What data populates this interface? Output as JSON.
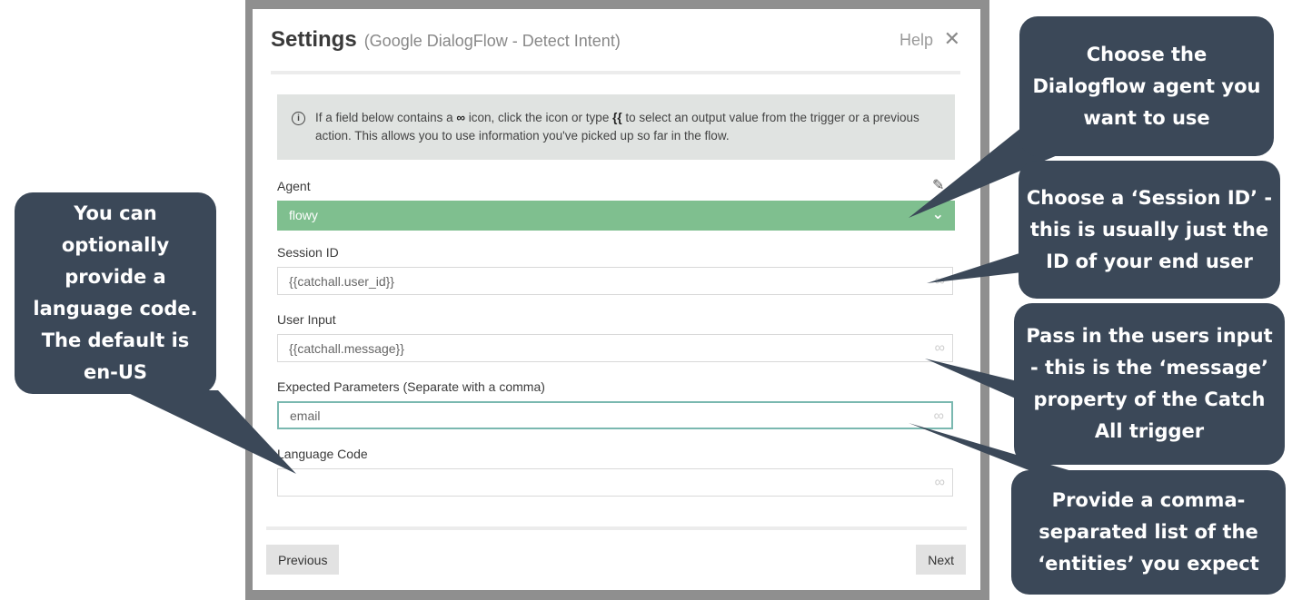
{
  "modal": {
    "title": "Settings",
    "subtitle": "(Google DialogFlow - Detect Intent)",
    "help_label": "Help",
    "close_glyph": "✕"
  },
  "info": {
    "icon": "info-icon",
    "text_part1": "If a field below contains a",
    "text_icon": "∞",
    "text_part2": "icon, click the icon or type",
    "text_braces": "{{",
    "text_part3": "to select an output value from the trigger or a previous action. This allows you to use information you've picked up so far in the flow."
  },
  "fields": {
    "agent": {
      "label": "Agent",
      "value": "flowy"
    },
    "session_id": {
      "label": "Session ID",
      "value": "{{catchall.user_id}}"
    },
    "user_input": {
      "label": "User Input",
      "value": "{{catchall.message}}"
    },
    "expected_params": {
      "label": "Expected Parameters (Separate with a comma)",
      "value": "email"
    },
    "language_code": {
      "label": "Language Code",
      "value": ""
    }
  },
  "buttons": {
    "previous": "Previous",
    "next": "Next"
  },
  "callouts": {
    "agent": "Choose the Dialogflow agent you want to use",
    "session": "Choose a ‘Session ID’ - this is usually just the ID of your end user",
    "input": "Pass in the users input - this is the ‘message’ property of the Catch All trigger",
    "params": "Provide a comma-separated list of the ‘entities’ you expect",
    "language": "You can optionally provide a language code. The default is en-US"
  },
  "colors": {
    "callout_bg": "#3b4858",
    "agent_select": "#7fbf8f",
    "active_border": "#7ab8b0",
    "info_bg": "#e0e3e1"
  }
}
